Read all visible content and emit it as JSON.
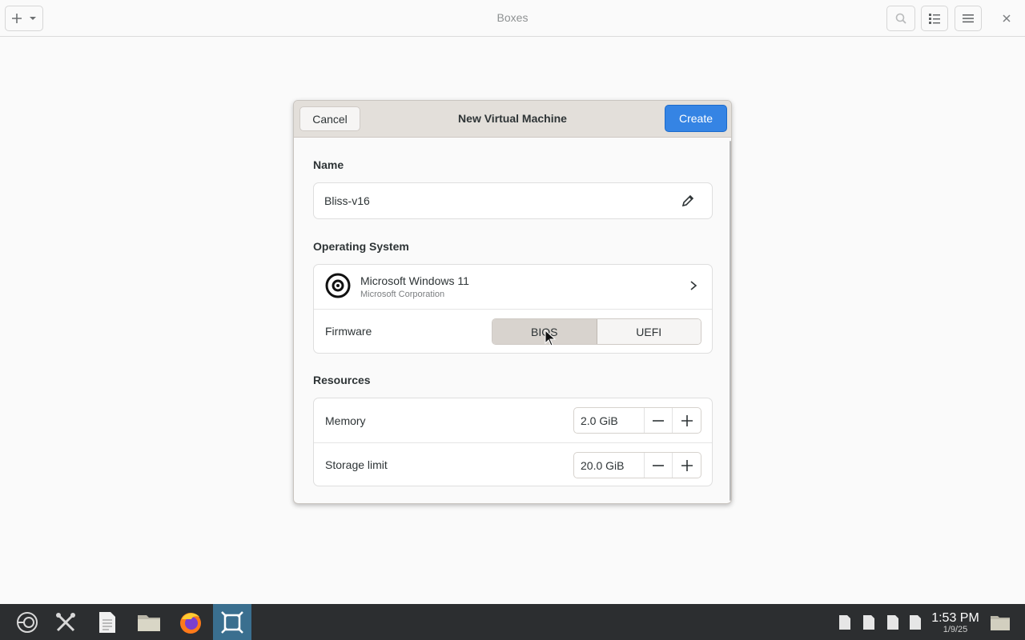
{
  "app": {
    "title": "Boxes",
    "header_icons": [
      "add-icon",
      "chevron-down-icon",
      "search-icon",
      "list-view-icon",
      "hamburger-menu-icon",
      "close-icon"
    ]
  },
  "dialog": {
    "title": "New Virtual Machine",
    "cancel_label": "Cancel",
    "create_label": "Create",
    "accent_color": "#3584e4",
    "name_section": {
      "label": "Name",
      "value": "Bliss-v16"
    },
    "os_section": {
      "label": "Operating System",
      "os_name": "Microsoft Windows 11",
      "os_vendor": "Microsoft Corporation",
      "firmware_label": "Firmware",
      "firmware_options": [
        "BIOS",
        "UEFI"
      ],
      "firmware_selected": "BIOS"
    },
    "resources_section": {
      "label": "Resources",
      "memory_label": "Memory",
      "memory_value": "2.0 GiB",
      "storage_label": "Storage limit",
      "storage_value": "20.0 GiB"
    }
  },
  "taskbar": {
    "apps": [
      "system-menu-icon",
      "settings-tools-icon",
      "text-editor-icon",
      "file-manager-icon",
      "firefox-icon",
      "boxes-icon"
    ],
    "active_app": "boxes-icon",
    "clock_time": "1:53 PM",
    "clock_date": "1/9/25"
  }
}
